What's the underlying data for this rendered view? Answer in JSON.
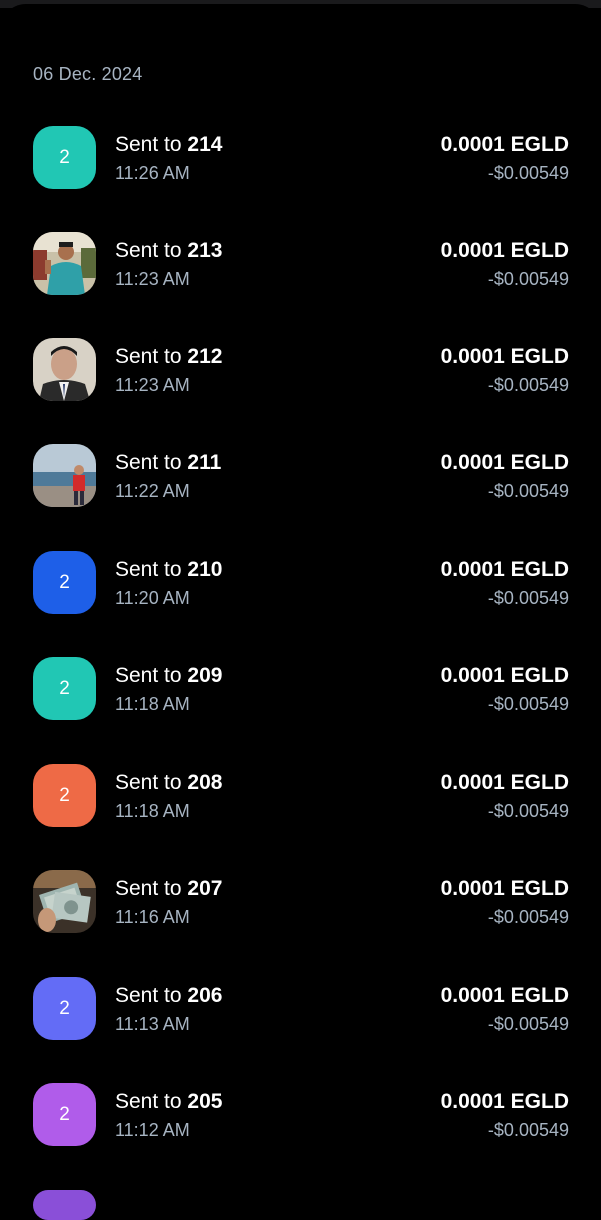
{
  "date_header": "06 Dec. 2024",
  "sent_prefix": "Sent to",
  "transactions": [
    {
      "recipient": "214",
      "time": "11:26 AM",
      "amount": "0.0001 EGLD",
      "fiat": "-$0.00549",
      "avatar": {
        "type": "letter",
        "text": "2",
        "color": "#21c7b4"
      }
    },
    {
      "recipient": "213",
      "time": "11:23 AM",
      "amount": "0.0001 EGLD",
      "fiat": "-$0.00549",
      "avatar": {
        "type": "photo",
        "icon": "photo-person-outdoor-icon"
      }
    },
    {
      "recipient": "212",
      "time": "11:23 AM",
      "amount": "0.0001 EGLD",
      "fiat": "-$0.00549",
      "avatar": {
        "type": "photo",
        "icon": "photo-portrait-icon"
      }
    },
    {
      "recipient": "211",
      "time": "11:22 AM",
      "amount": "0.0001 EGLD",
      "fiat": "-$0.00549",
      "avatar": {
        "type": "photo",
        "icon": "photo-beach-icon"
      }
    },
    {
      "recipient": "210",
      "time": "11:20 AM",
      "amount": "0.0001 EGLD",
      "fiat": "-$0.00549",
      "avatar": {
        "type": "letter",
        "text": "2",
        "color": "#1e5fe8"
      }
    },
    {
      "recipient": "209",
      "time": "11:18 AM",
      "amount": "0.0001 EGLD",
      "fiat": "-$0.00549",
      "avatar": {
        "type": "letter",
        "text": "2",
        "color": "#21c7b4"
      }
    },
    {
      "recipient": "208",
      "time": "11:18 AM",
      "amount": "0.0001 EGLD",
      "fiat": "-$0.00549",
      "avatar": {
        "type": "letter",
        "text": "2",
        "color": "#ee6a46"
      }
    },
    {
      "recipient": "207",
      "time": "11:16 AM",
      "amount": "0.0001 EGLD",
      "fiat": "-$0.00549",
      "avatar": {
        "type": "photo",
        "icon": "photo-banknotes-icon"
      }
    },
    {
      "recipient": "206",
      "time": "11:13 AM",
      "amount": "0.0001 EGLD",
      "fiat": "-$0.00549",
      "avatar": {
        "type": "letter",
        "text": "2",
        "color": "#636cf6"
      }
    },
    {
      "recipient": "205",
      "time": "11:12 AM",
      "amount": "0.0001 EGLD",
      "fiat": "-$0.00549",
      "avatar": {
        "type": "letter",
        "text": "2",
        "color": "#b05cea"
      }
    }
  ]
}
